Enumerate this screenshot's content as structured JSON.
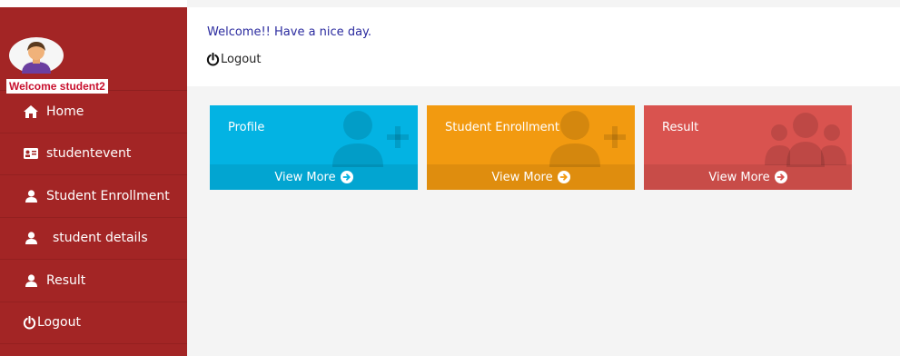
{
  "sidebar": {
    "welcome": "Welcome student2",
    "items": [
      {
        "label": "Home",
        "icon": "home-icon"
      },
      {
        "label": "studentevent",
        "icon": "id-card-icon"
      },
      {
        "label": "Student Enrollment",
        "icon": "user-icon"
      },
      {
        "label": "student details",
        "icon": "user-icon"
      },
      {
        "label": "Result",
        "icon": "user-icon"
      },
      {
        "label": "Logout",
        "icon": "power-icon"
      }
    ]
  },
  "header": {
    "greeting": "Welcome!! Have a nice day.",
    "logout": "Logout"
  },
  "cards": [
    {
      "title": "Profile",
      "link": "View More",
      "color": "#03b3e3"
    },
    {
      "title": "Student Enrollment",
      "link": "View More",
      "color": "#f29a10"
    },
    {
      "title": "Result",
      "link": "View More",
      "color": "#d9534f"
    }
  ],
  "colors": {
    "sidebar": "#a32525",
    "greeting": "#2b2b9f",
    "welcome_badge_text": "#c8102e"
  }
}
